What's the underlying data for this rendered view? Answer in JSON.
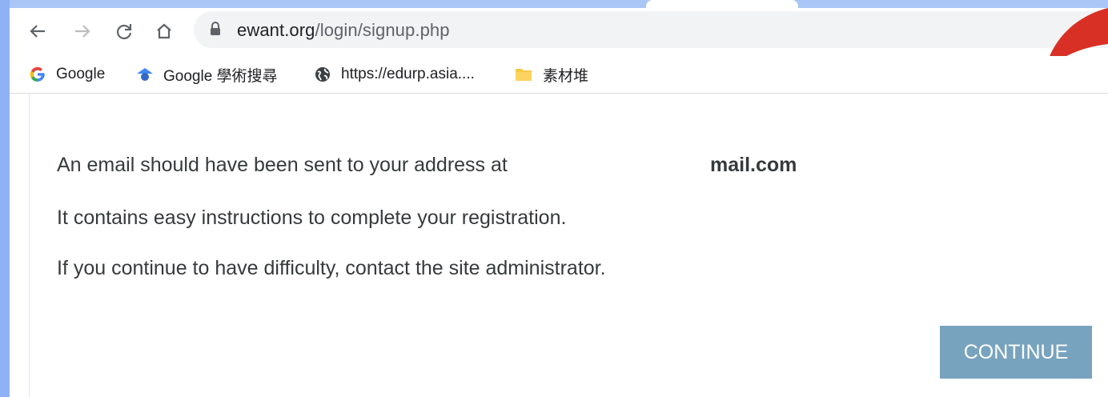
{
  "browser": {
    "url_domain": "ewant.org",
    "url_path": "/login/signup.php",
    "icons": [
      "back-arrow-icon",
      "forward-arrow-icon",
      "reload-icon",
      "home-icon",
      "lock-icon"
    ]
  },
  "bookmarks": [
    {
      "label": "Google",
      "icon": "google-g-icon"
    },
    {
      "label": "Google 學術搜尋",
      "icon": "google-scholar-icon"
    },
    {
      "label": "https://edurp.asia....",
      "icon": "globe-icon"
    },
    {
      "label": "素材堆",
      "icon": "folder-icon"
    }
  ],
  "message": {
    "line1": "An email should have been sent to your address at",
    "email": "mail.com",
    "line2": "It contains easy instructions to complete your registration.",
    "line3": "If you continue to have difficulty, contact the site administrator."
  },
  "continue_button": "CONTINUE",
  "colors": {
    "page_background": "#8fb2f5",
    "button": "#78a3bf",
    "annotation_red": "#d93025",
    "text": "#373a3c"
  }
}
